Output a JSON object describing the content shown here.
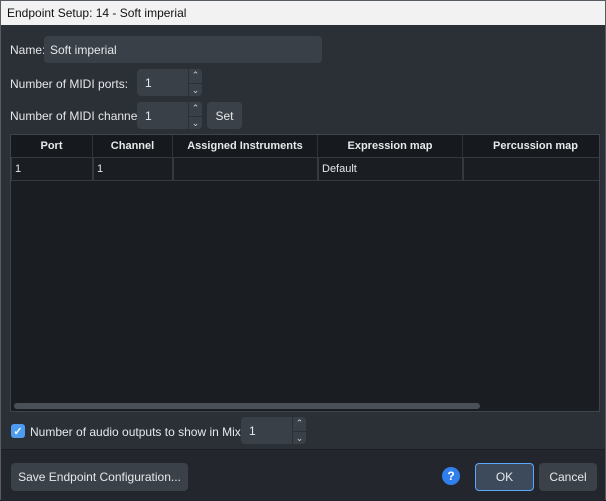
{
  "window": {
    "title": "Endpoint Setup: 14 - Soft imperial"
  },
  "form": {
    "name_label": "Name:",
    "name_value": "Soft imperial",
    "ports_label": "Number of MIDI ports:",
    "ports_value": "1",
    "channels_label": "Number of MIDI channels:",
    "channels_value": "1",
    "set_label": "Set"
  },
  "icons": {
    "spin_up": "chevron-up-icon",
    "spin_down": "chevron-down-icon",
    "check": "checkmark-icon",
    "help": "question-icon"
  },
  "table": {
    "columns": [
      "Port",
      "Channel",
      "Assigned Instruments",
      "Expression map",
      "Percussion map"
    ],
    "rows": [
      [
        "1",
        "1",
        "",
        "Default",
        ""
      ]
    ]
  },
  "audio": {
    "label": "Number of audio outputs to show in Mixer:",
    "checked": true,
    "value": "1"
  },
  "footer": {
    "save_label": "Save Endpoint Configuration...",
    "help_symbol": "?",
    "ok_label": "OK",
    "cancel_label": "Cancel"
  },
  "colors": {
    "accent": "#2f80ed",
    "background": "#2b3037",
    "grid_bg": "#1a1e23"
  }
}
